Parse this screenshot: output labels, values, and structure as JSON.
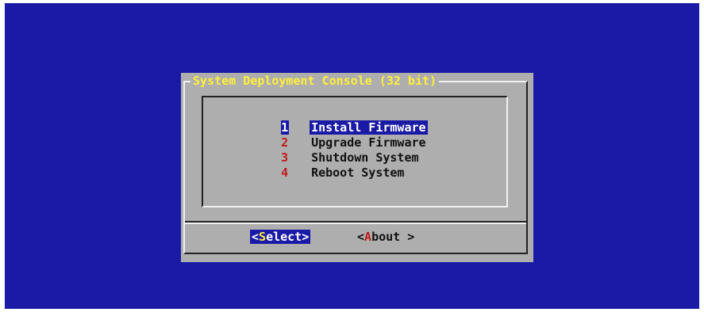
{
  "dialog": {
    "title": "System Deployment Console (32 bit)"
  },
  "menu": {
    "items": [
      {
        "num": "1",
        "label": "Install Firmware",
        "selected": true
      },
      {
        "num": "2",
        "label": "Upgrade Firmware",
        "selected": false
      },
      {
        "num": "3",
        "label": "Shutdown System",
        "selected": false
      },
      {
        "num": "4",
        "label": "Reboot System",
        "selected": false
      }
    ]
  },
  "buttons": {
    "select": {
      "open": "<",
      "hot": "S",
      "rest": "elect",
      "close": ">"
    },
    "about": {
      "open": "<",
      "hot": "A",
      "rest": "bout",
      "close": " >"
    }
  },
  "colors": {
    "background": "#1b1aa6",
    "dialog": "#aeaeae",
    "title": "#ffef3a",
    "hotkey": "#c21b1b",
    "selection": "#1b1aa6"
  }
}
